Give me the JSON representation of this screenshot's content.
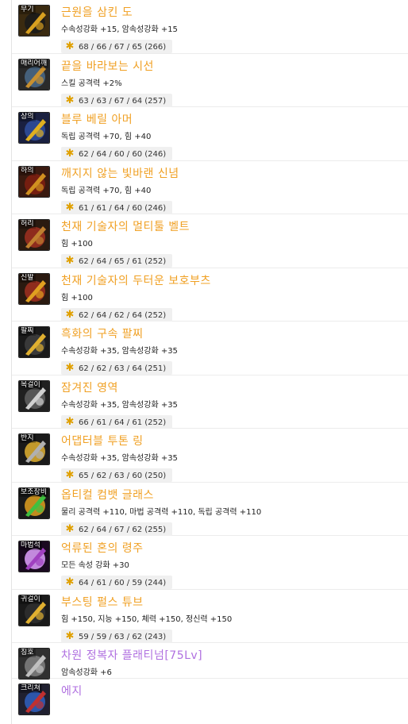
{
  "colors": {
    "name_orange": "#f0a023",
    "name_purple": "#b070e0",
    "star": "#e0a000"
  },
  "items": [
    {
      "slot": "무기",
      "name": "근원을 삼킨 도",
      "stats": "수속성강화 +15, 암속성강화 +15",
      "score": "68 / 66 / 67 / 65 (266)",
      "name_color": "#f0a023",
      "icon": "sword-icon",
      "icon_colors": [
        "#3a2a10",
        "#d8a020",
        "#1a1a1a"
      ]
    },
    {
      "slot": "매리어깨",
      "name": "끝을 바라보는 시선",
      "stats": "스킬 공격력 +2%",
      "score": "63 / 63 / 67 / 64 (257)",
      "name_color": "#f0a023",
      "icon": "shoulder-icon",
      "icon_colors": [
        "#2a2a2a",
        "#c89030",
        "#4a6a8a"
      ]
    },
    {
      "slot": "상의",
      "name": "블루 베릴 아머",
      "stats": "독립 공격력 +70, 힘 +40",
      "score": "62 / 64 / 60 / 60 (246)",
      "name_color": "#f0a023",
      "icon": "armor-icon",
      "icon_colors": [
        "#1a2040",
        "#e0b020",
        "#3050a0"
      ]
    },
    {
      "slot": "하의",
      "name": "깨지지 않는 빛바랜 신념",
      "stats": "독립 공격력 +70, 힘 +40",
      "score": "61 / 61 / 64 / 60 (246)",
      "name_color": "#f0a023",
      "icon": "pants-icon",
      "icon_colors": [
        "#3a1a10",
        "#d09020",
        "#802010"
      ]
    },
    {
      "slot": "허리",
      "name": "천재 기술자의 멀티툴 벨트",
      "stats": "힘 +100",
      "score": "62 / 64 / 65 / 61 (252)",
      "name_color": "#f0a023",
      "icon": "belt-icon",
      "icon_colors": [
        "#2a1a10",
        "#c08030",
        "#a03020"
      ]
    },
    {
      "slot": "신발",
      "name": "천재 기술자의 두터운 보호부츠",
      "stats": "힘 +100",
      "score": "62 / 64 / 62 / 64 (252)",
      "name_color": "#f0a023",
      "icon": "boots-icon",
      "icon_colors": [
        "#2a1a10",
        "#e0a020",
        "#a03020"
      ]
    },
    {
      "slot": "팔찌",
      "name": "흑화의 구속 팔찌",
      "stats": "수속성강화 +35, 암속성강화 +35",
      "score": "62 / 62 / 63 / 64 (251)",
      "name_color": "#f0a023",
      "icon": "bracelet-icon",
      "icon_colors": [
        "#1a1a1a",
        "#e0b030",
        "#404040"
      ]
    },
    {
      "slot": "목걸이",
      "name": "잠겨진 영역",
      "stats": "수속성강화 +35, 암속성강화 +35",
      "score": "66 / 61 / 64 / 61 (252)",
      "name_color": "#f0a023",
      "icon": "necklace-icon",
      "icon_colors": [
        "#202020",
        "#d0d0d0",
        "#606060"
      ]
    },
    {
      "slot": "반지",
      "name": "어댑터블 투톤 링",
      "stats": "수속성강화 +35, 암속성강화 +35",
      "score": "65 / 62 / 63 / 60 (250)",
      "name_color": "#f0a023",
      "icon": "ring-icon",
      "icon_colors": [
        "#1a1a1a",
        "#b0b0b0",
        "#e0b030"
      ]
    },
    {
      "slot": "보조장비",
      "name": "옵티컬 컴뱃 글래스",
      "stats": "물리 공격력 +110, 마법 공격력 +110, 독립 공격력 +110",
      "score": "62 / 64 / 67 / 62 (255)",
      "name_color": "#f0a023",
      "icon": "glasses-icon",
      "icon_colors": [
        "#1a1a1a",
        "#40c040",
        "#e0a020"
      ]
    },
    {
      "slot": "마법석",
      "name": "억류된 혼의 령주",
      "stats": "모든 속성 강화 +30",
      "score": "64 / 61 / 60 / 59 (244)",
      "name_color": "#f0a023",
      "icon": "orb-icon",
      "icon_colors": [
        "#1a0a20",
        "#a040c0",
        "#e0a0ff"
      ]
    },
    {
      "slot": "귀걸이",
      "name": "부스팅 펄스 튜브",
      "stats": "힘 +150, 지능 +150, 체력 +150, 정신력 +150",
      "score": "59 / 59 / 63 / 62 (243)",
      "name_color": "#f0a023",
      "icon": "earring-icon",
      "icon_colors": [
        "#1a1a1a",
        "#e0b030",
        "#303030"
      ]
    },
    {
      "slot": "칭호",
      "name": "차원 정복자 플래티넘[75Lv]",
      "stats": "암속성강화 +6",
      "score": "",
      "name_color": "#b070e0",
      "icon": "title-icon",
      "icon_colors": [
        "#303030",
        "#c0c0c0",
        "#808080"
      ]
    },
    {
      "slot": "크리쳐",
      "name": "에지",
      "stats": "",
      "score": "",
      "name_color": "#b070e0",
      "icon": "creature-icon",
      "icon_colors": [
        "#202030",
        "#c03030",
        "#3060c0"
      ]
    }
  ]
}
